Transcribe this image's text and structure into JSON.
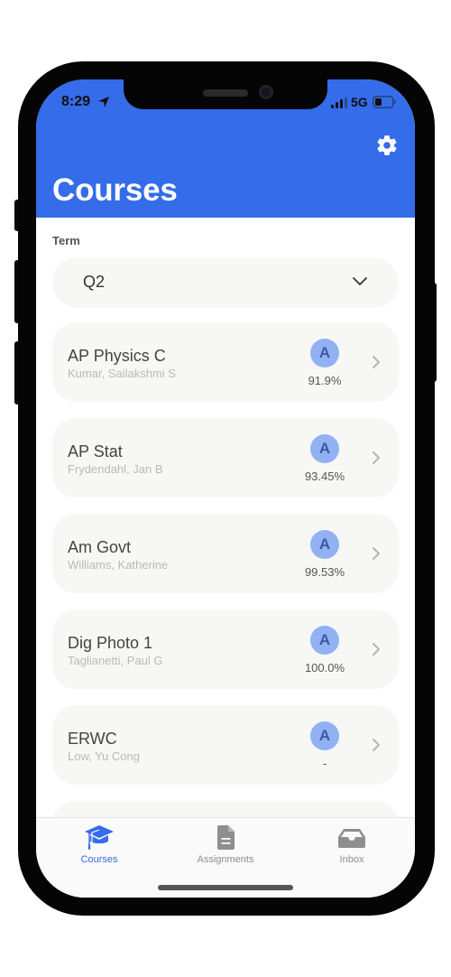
{
  "status_bar": {
    "time": "8:29",
    "network": "5G"
  },
  "header": {
    "title": "Courses",
    "accent_color": "#346ce9"
  },
  "term": {
    "label": "Term",
    "selected": "Q2"
  },
  "courses": [
    {
      "name": "AP Physics C",
      "teacher": "Kumar, Sailakshmi S",
      "grade": "A",
      "percent": "91.9%"
    },
    {
      "name": "AP Stat",
      "teacher": "Frydendahl, Jan B",
      "grade": "A",
      "percent": "93.45%"
    },
    {
      "name": "Am Govt",
      "teacher": "Williams, Katherine",
      "grade": "A",
      "percent": "99.53%"
    },
    {
      "name": "Dig Photo 1",
      "teacher": "Taglianetti, Paul G",
      "grade": "A",
      "percent": "100.0%"
    },
    {
      "name": "ERWC",
      "teacher": "Low, Yu Cong",
      "grade": "A",
      "percent": "-"
    },
    {
      "name": "",
      "teacher": "",
      "grade": "",
      "percent": ""
    }
  ],
  "tabbar": {
    "tabs": [
      {
        "label": "Courses",
        "icon": "graduation-cap-icon",
        "active": true,
        "color": "#346ce9"
      },
      {
        "label": "Assignments",
        "icon": "document-icon",
        "active": false,
        "color": "#8e8e8e"
      },
      {
        "label": "Inbox",
        "icon": "inbox-tray-icon",
        "active": false,
        "color": "#8e8e8e"
      }
    ]
  }
}
